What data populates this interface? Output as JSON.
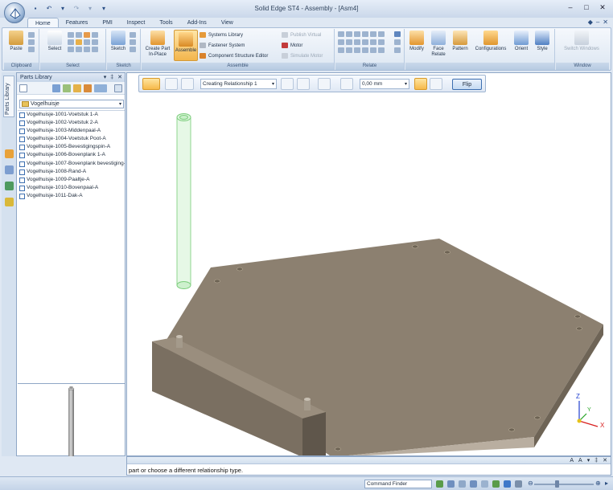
{
  "window": {
    "title": "Solid Edge ST4 - Assembly - [Asm4]",
    "controls": [
      "–",
      "□",
      "✕"
    ]
  },
  "qat": [
    "💾",
    "↶",
    "▾",
    "↷",
    "▾",
    "▾"
  ],
  "tabs": [
    {
      "label": "Home",
      "active": true
    },
    {
      "label": "Features"
    },
    {
      "label": "PMI"
    },
    {
      "label": "Inspect"
    },
    {
      "label": "Tools"
    },
    {
      "label": "Add-Ins"
    },
    {
      "label": "View"
    }
  ],
  "tab_right_icons": [
    "help-icon",
    "minimize-ribbon-icon",
    "close-doc-icon"
  ],
  "ribbon": {
    "groups": [
      "Clipboard",
      "Select",
      "Sketch",
      "Assemble",
      "Relate",
      "Window"
    ],
    "paste": "Paste",
    "select": "Select",
    "sketch": "Sketch",
    "create_part": "Create Part In-Place",
    "assemble": "Assemble",
    "systems_library": "Systems Library",
    "fastener_system": "Fastener System",
    "component_structure_editor": "Component Structure Editor",
    "publish_virtual": "Publish Virtual",
    "motor": "Motor",
    "simulate_motor": "Simulate Motor",
    "modify": "Modify",
    "face_relate": "Face Relate",
    "pattern": "Pattern",
    "configurations": "Configurations",
    "orient": "Orient",
    "style": "Style",
    "switch_windows": "Switch Windows"
  },
  "parts_library": {
    "title": "Parts Library",
    "side_tab": "Parts Library",
    "folder": "Vogelhuisje",
    "items": [
      "Vogelhuisje-1001-Voetstuk 1-A",
      "Vogelhuisje-1002-Voetstuk 2-A",
      "Vogelhuisje-1003-Middenpaal-A",
      "Vogelhuisje-1004-Voetstuk Poot-A",
      "Vogelhuisje-1005-Bevestigingspin-A",
      "Vogelhuisje-1006-Bovenplank 1-A",
      "Vogelhuisje-1007-Bovenplank bevestiging-",
      "Vogelhuisje-1008-Rand-A",
      "Vogelhuisje-1009-Paaltje-A",
      "Vogelhuisje-1010-Bovenpaal-A",
      "Vogelhuisje-1011-Dak-A"
    ]
  },
  "command_bar": {
    "relationship": "Creating Relationship 1",
    "offset": "0,00 mm",
    "flip": "Flip"
  },
  "prompt": {
    "text": "part or choose a different relationship type."
  },
  "status": {
    "command_finder": "Command Finder"
  },
  "triad": {
    "x": "X",
    "y": "Y",
    "z": "Z"
  },
  "colors": {
    "plate": "#8c7f6e",
    "ghost": "#9be39b",
    "accent": "#f6b94a"
  }
}
